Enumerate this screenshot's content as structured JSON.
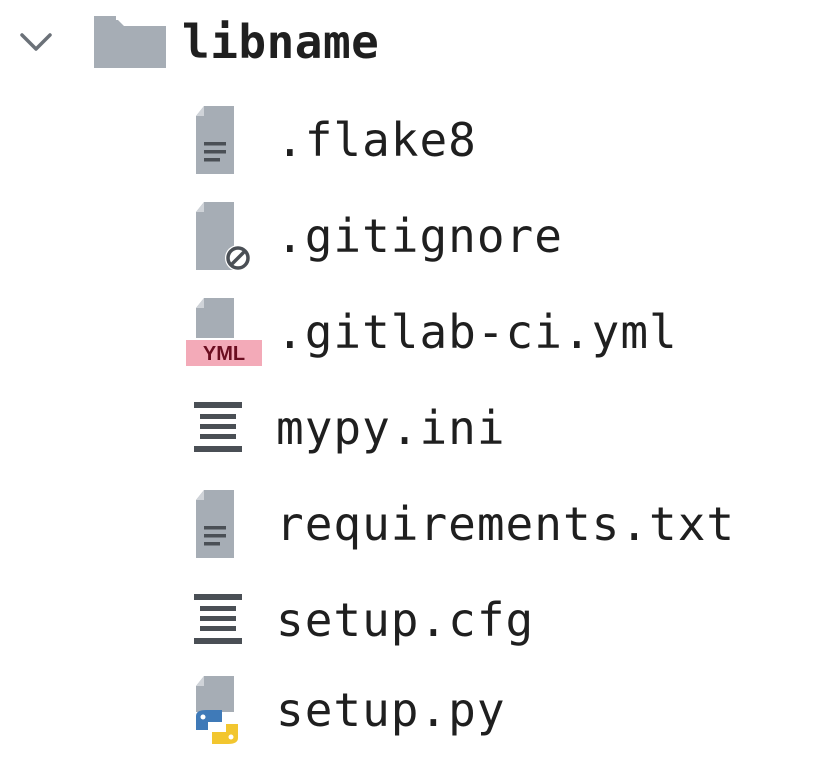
{
  "tree": {
    "root": {
      "label": "libname",
      "state": "expanded",
      "icon": "folder-icon",
      "chevron_icon": "chevron-down-icon"
    },
    "files": [
      {
        "label": ".flake8",
        "icon": "text-file-icon"
      },
      {
        "label": ".gitignore",
        "icon": "gitignore-file-icon"
      },
      {
        "label": ".gitlab-ci.yml",
        "icon": "yml-file-icon",
        "badge": "YML"
      },
      {
        "label": "mypy.ini",
        "icon": "config-file-icon"
      },
      {
        "label": "requirements.txt",
        "icon": "text-file-icon"
      },
      {
        "label": "setup.cfg",
        "icon": "config-file-icon"
      },
      {
        "label": "setup.py",
        "icon": "python-file-icon"
      }
    ]
  },
  "colors": {
    "text": "#1f1f1f",
    "icon_gray": "#a6adb5",
    "icon_dark": "#4a4f55",
    "yml_badge_bg": "#f3aab8",
    "yml_badge_text": "#6b0d20",
    "python_blue": "#3f7ab8",
    "python_yellow": "#f2c62f"
  }
}
